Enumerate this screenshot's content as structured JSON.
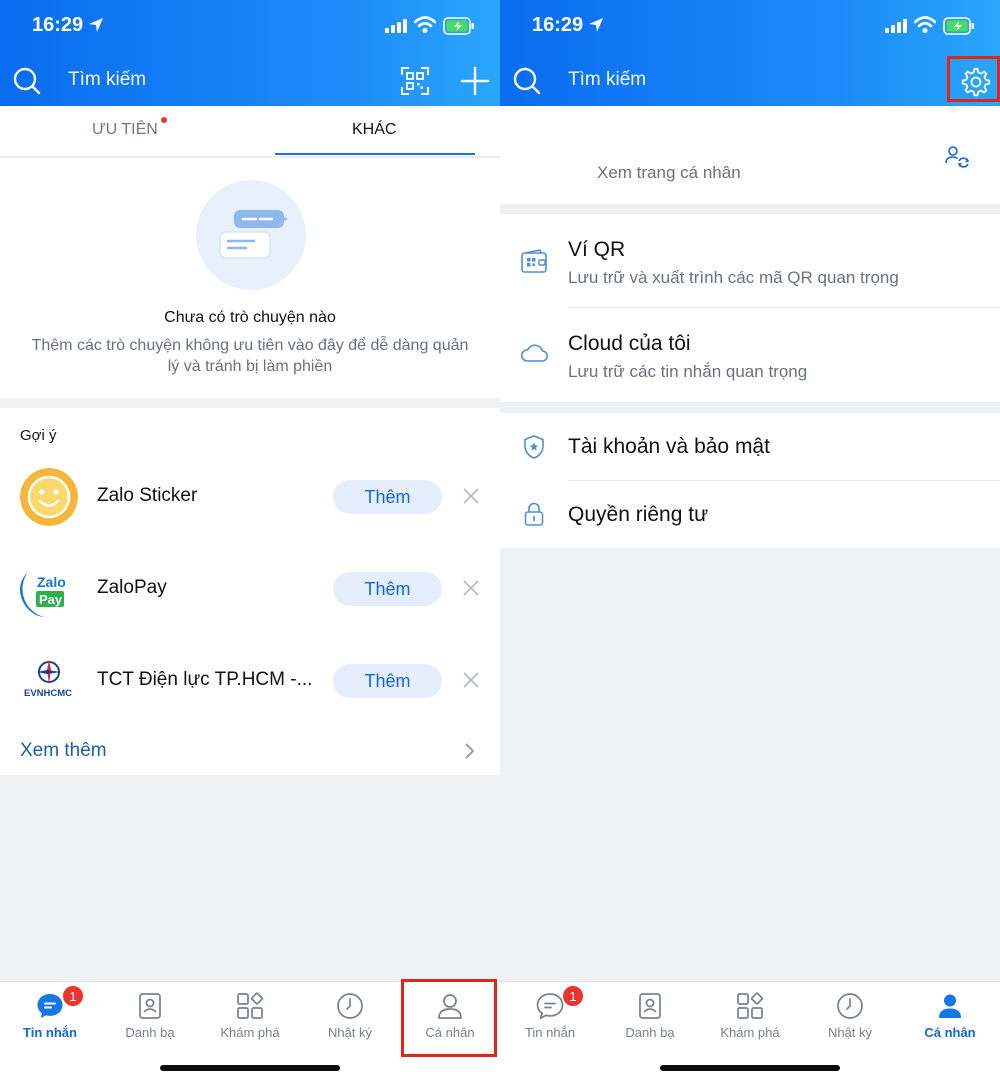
{
  "status_bar": {
    "time": "16:29"
  },
  "colors": {
    "header_blue": "#0a6cf0",
    "accent": "#1466d4",
    "badge_red": "#e9352b",
    "highlight_box": "#e0261b"
  },
  "left_screen": {
    "search_placeholder": "Tìm kiếm",
    "tabs": [
      "ƯU TIÊN",
      "KHÁC"
    ],
    "active_tab": "KHÁC",
    "empty_state": {
      "title": "Chưa có trò chuyện nào",
      "description": "Thêm các trò chuyện không ưu tiên vào đây để dễ dàng quản lý và tránh bị làm phiền"
    },
    "suggestions": {
      "header": "Gợi ý",
      "items": [
        {
          "name": "Zalo Sticker",
          "button": "Thêm"
        },
        {
          "name": "ZaloPay",
          "button": "Thêm",
          "logo_text": [
            "Zalo",
            "Pay"
          ]
        },
        {
          "name": "TCT Điện lực TP.HCM -...",
          "button": "Thêm",
          "logo_text": "EVNHCMC"
        }
      ],
      "see_more": "Xem thêm"
    }
  },
  "right_screen": {
    "search_placeholder": "Tìm kiếm",
    "profile_link": "Xem trang cá nhân",
    "items": [
      {
        "title": "Ví QR",
        "subtitle": "Lưu trữ và xuất trình các mã QR quan trọng"
      },
      {
        "title": "Cloud của tôi",
        "subtitle": "Lưu trữ các tin nhắn quan trọng"
      },
      {
        "title": "Tài khoản và bảo mật"
      },
      {
        "title": "Quyền riêng tư"
      }
    ]
  },
  "bottom_nav": {
    "items": [
      "Tin nhắn",
      "Danh bạ",
      "Khám phá",
      "Nhật ký",
      "Cá nhân"
    ],
    "badge_count": "1",
    "left_active": "Tin nhắn",
    "right_active": "Cá nhân"
  }
}
